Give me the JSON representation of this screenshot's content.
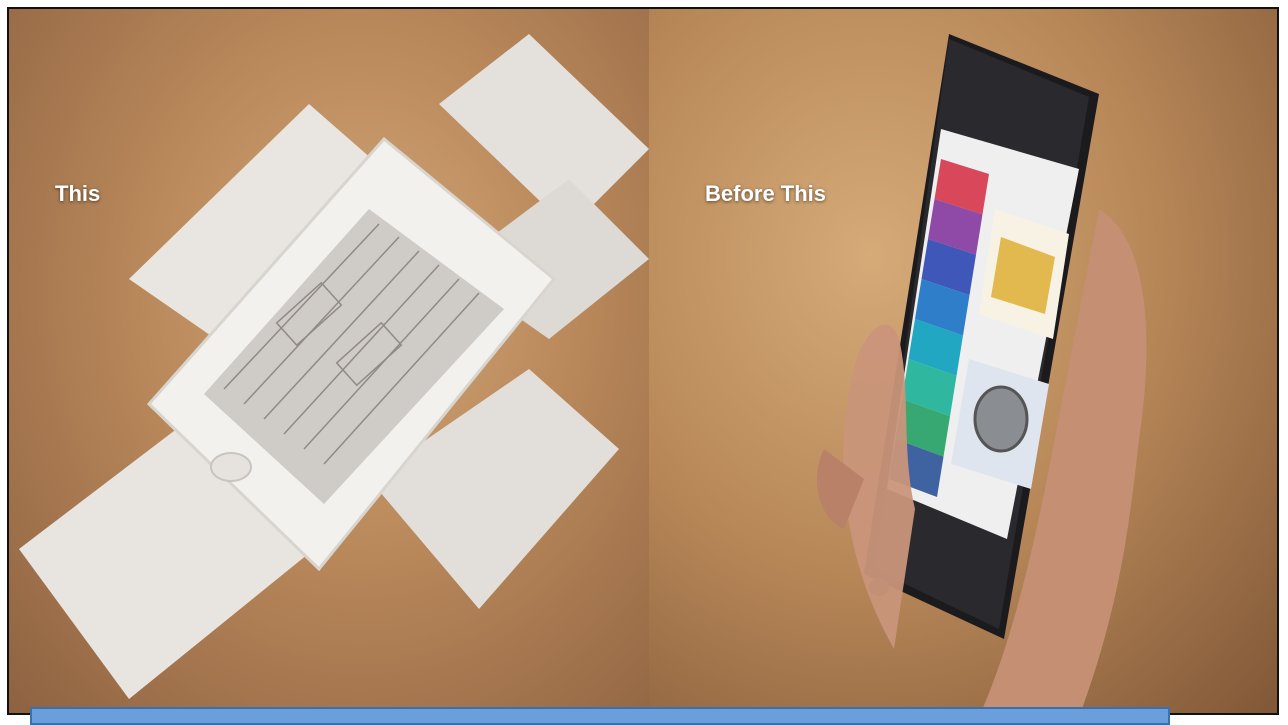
{
  "captions": {
    "left": "This",
    "right": "Before This"
  },
  "colors": {
    "bottom_bar": "#6a9fdb",
    "menu": [
      "#d9485a",
      "#8e4aa6",
      "#3e57b8",
      "#2f7ec9",
      "#22a7c2",
      "#2fb7a0",
      "#38a873",
      "#3e63a0"
    ]
  }
}
